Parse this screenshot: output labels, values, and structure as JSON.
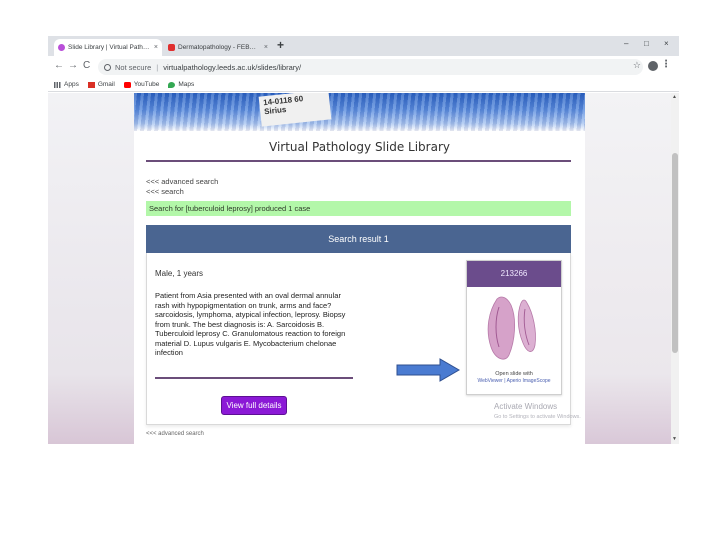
{
  "browser": {
    "tabs": [
      {
        "title": "Slide Library | Virtual Pathology ...",
        "close": "×",
        "active": true
      },
      {
        "title": "Dermatopathology - FEBOSY - I ...",
        "close": "×",
        "active": false
      }
    ],
    "new_tab": "+",
    "window_controls": {
      "minimize": "–",
      "restore": "□",
      "close": "×"
    },
    "nav": {
      "back": "←",
      "forward": "→",
      "reload": "C"
    },
    "address": {
      "security": "Not secure",
      "separator": "|",
      "url": "virtualpathology.leeds.ac.uk/slides/library/"
    },
    "star": "☆",
    "menu": "⋮",
    "bookmarks": [
      {
        "label": "Apps",
        "icon": "apps-grid-icon"
      },
      {
        "label": "Gmail",
        "icon": "gmail-icon"
      },
      {
        "label": "YouTube",
        "icon": "youtube-icon"
      },
      {
        "label": "Maps",
        "icon": "maps-icon"
      }
    ]
  },
  "page": {
    "banner_label": "14-0118 60 Sirius",
    "site_title": "Virtual Pathology Slide Library",
    "advanced_search_link": "<<< advanced search",
    "search_link": "<<< search",
    "result_info": "Search for [tuberculoid leprosy] produced 1 case",
    "result_header": "Search result 1",
    "case": {
      "heading": "Male, 1 years",
      "text": "Patient from Asia presented with an oval dermal annular rash with hypopigmentation on trunk, arms and face? sarcoidosis, lymphoma, atypical infection, leprosy. Biopsy from trunk. The best diagnosis is: A. Sarcoidosis B. Tuberculoid leprosy C. Granulomatous reaction to foreign material D. Lupus vulgaris E. Mycobacterium chelonae infection",
      "button": "View full details"
    },
    "thumbnail": {
      "slide_id": "213266",
      "caption_line1": "Open slide with",
      "caption_line2": "WebViewer | Aperio ImageScope"
    },
    "below_text": "<<< advanced search"
  },
  "os_overlay": {
    "title": "Activate Windows",
    "subtitle": "Go to Settings to activate Windows."
  },
  "colors": {
    "result_header": "#4a6591",
    "result_info_bg": "#b3f7a9",
    "button": "#8b19d6",
    "rule": "#6b4d7a",
    "arrow_fill": "#4a7bd1"
  }
}
